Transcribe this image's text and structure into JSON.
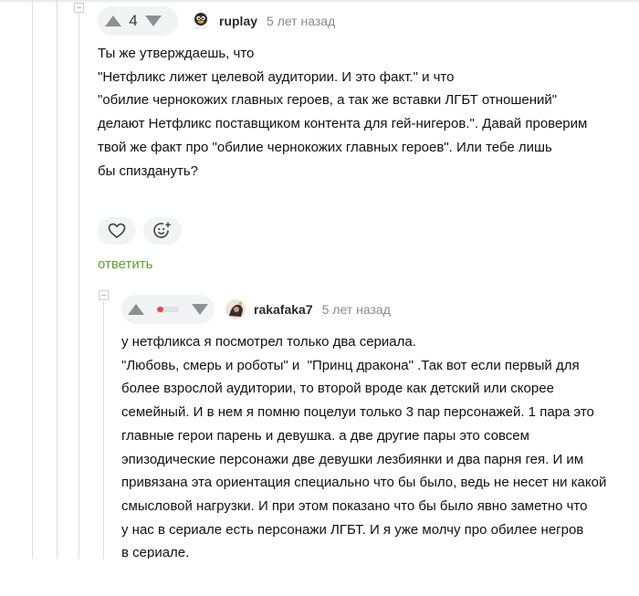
{
  "comment1": {
    "rating": "4",
    "username": "ruplay",
    "timestamp": "5 лет назад",
    "lines": [
      "Ты же утверждаешь, что",
      "",
      "\"Нетфликс лижет целевой аудитории. И это факт.\" и что",
      "\"обилие чернокожих главных героев, а так же вставки ЛГБТ отношений\"",
      "делают Нетфликс поставщиком контента для гей-нигеров.\". Давай проверим",
      "твой же факт про \"обилие чернокожих главных героев\". Или тебе лишь",
      "бы спиздануть?"
    ],
    "like_icon": "heart-icon",
    "reaction_icon": "smiley-add-icon",
    "reply_label": "ответить"
  },
  "comment2": {
    "username": "rakafaka7",
    "timestamp": "5 лет назад",
    "rating_fraction": 0.3,
    "lines": [
      "у нетфликса я посмотрел только два сериала.",
      "\"Любовь, смерь и роботы\" и  \"Принц дракона\" .Так вот если первый для",
      "более взрослой аудитории, то второй вроде как детский или скорее",
      "семейный. И в нем я помню поцелуи только 3 пар персонажей. 1 пара это",
      "главные герои парень и девушка. а две другие пары это совсем",
      "эпизодические персонажи две девушки лезбиянки и два парня гея. И им",
      "привязана эта ориентация специально что бы было, ведь не несет ни какой",
      "смысловой нагрузки. И при этом показано что бы было явно заметно что",
      "у нас в сериале есть персонажи ЛГБТ. И я уже молчу про обилее негров",
      "в сериале."
    ]
  },
  "colors": {
    "accent_green": "#5aa033",
    "negative_red": "#e64a4a",
    "arrow_gray": "#8e9094"
  }
}
